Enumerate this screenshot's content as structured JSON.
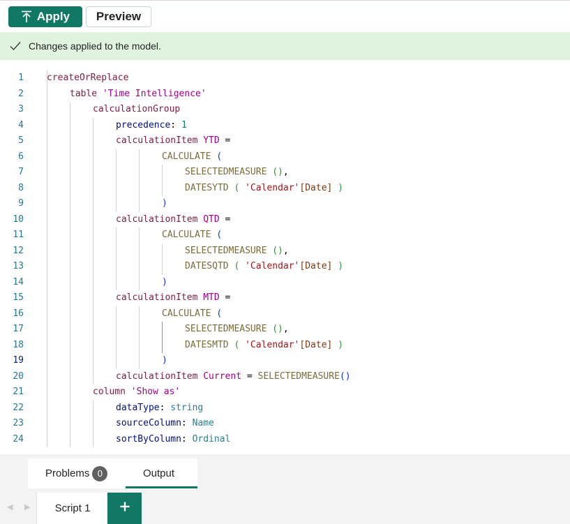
{
  "toolbar": {
    "apply_label": "Apply",
    "preview_label": "Preview"
  },
  "banner": {
    "message": "Changes applied to the model."
  },
  "editor": {
    "active_line": 19,
    "lines": [
      {
        "n": "1",
        "indent": 0,
        "tokens": [
          [
            "createOrReplace",
            "pur"
          ]
        ]
      },
      {
        "n": "2",
        "indent": 1,
        "tokens": [
          [
            "table ",
            "pur"
          ],
          [
            "'Time Intelligence'",
            "ident"
          ]
        ]
      },
      {
        "n": "3",
        "indent": 2,
        "tokens": [
          [
            "calculationGroup",
            "pur"
          ]
        ]
      },
      {
        "n": "4",
        "indent": 3,
        "tokens": [
          [
            "precedence",
            "kw"
          ],
          [
            ": ",
            "plain"
          ],
          [
            "1",
            "num"
          ]
        ]
      },
      {
        "n": "5",
        "indent": 3,
        "tokens": [
          [
            "calculationItem ",
            "pur"
          ],
          [
            "YTD",
            "ident"
          ],
          [
            " =",
            "plain"
          ]
        ]
      },
      {
        "n": "6",
        "indent": 5,
        "tokens": [
          [
            "CALCULATE ",
            "fn"
          ],
          [
            "(",
            "p1"
          ]
        ]
      },
      {
        "n": "7",
        "indent": 6,
        "tokens": [
          [
            "SELECTEDMEASURE ",
            "fn"
          ],
          [
            "()",
            "p2"
          ],
          [
            ",",
            "plain"
          ]
        ]
      },
      {
        "n": "8",
        "indent": 6,
        "tokens": [
          [
            "DATESYTD ",
            "fn"
          ],
          [
            "(",
            "p2"
          ],
          [
            " ",
            "plain"
          ],
          [
            "'Calendar'",
            "str"
          ],
          [
            "[Date]",
            "p3"
          ],
          [
            " ",
            "plain"
          ],
          [
            ")",
            "p2"
          ]
        ]
      },
      {
        "n": "9",
        "indent": 5,
        "tokens": [
          [
            ")",
            "p1"
          ]
        ]
      },
      {
        "n": "10",
        "indent": 3,
        "tokens": [
          [
            "calculationItem ",
            "pur"
          ],
          [
            "QTD",
            "ident"
          ],
          [
            " =",
            "plain"
          ]
        ]
      },
      {
        "n": "11",
        "indent": 5,
        "tokens": [
          [
            "CALCULATE ",
            "fn"
          ],
          [
            "(",
            "p1"
          ]
        ]
      },
      {
        "n": "12",
        "indent": 6,
        "tokens": [
          [
            "SELECTEDMEASURE ",
            "fn"
          ],
          [
            "()",
            "p2"
          ],
          [
            ",",
            "plain"
          ]
        ]
      },
      {
        "n": "13",
        "indent": 6,
        "tokens": [
          [
            "DATESQTD ",
            "fn"
          ],
          [
            "(",
            "p2"
          ],
          [
            " ",
            "plain"
          ],
          [
            "'Calendar'",
            "str"
          ],
          [
            "[Date]",
            "p3"
          ],
          [
            " ",
            "plain"
          ],
          [
            ")",
            "p2"
          ]
        ]
      },
      {
        "n": "14",
        "indent": 5,
        "tokens": [
          [
            ")",
            "p1"
          ]
        ]
      },
      {
        "n": "15",
        "indent": 3,
        "tokens": [
          [
            "calculationItem ",
            "pur"
          ],
          [
            "MTD",
            "ident"
          ],
          [
            " =",
            "plain"
          ]
        ]
      },
      {
        "n": "16",
        "indent": 5,
        "tokens": [
          [
            "CALCULATE ",
            "fn"
          ],
          [
            "(",
            "p1"
          ]
        ]
      },
      {
        "n": "17",
        "indent": 6,
        "tokens": [
          [
            "SELECTEDMEASURE ",
            "fn"
          ],
          [
            "()",
            "p2"
          ],
          [
            ",",
            "plain"
          ]
        ]
      },
      {
        "n": "18",
        "indent": 6,
        "tokens": [
          [
            "DATESMTD ",
            "fn"
          ],
          [
            "(",
            "p2"
          ],
          [
            " ",
            "plain"
          ],
          [
            "'Calendar'",
            "str"
          ],
          [
            "[Date]",
            "p3"
          ],
          [
            " ",
            "plain"
          ],
          [
            ")",
            "p2"
          ]
        ]
      },
      {
        "n": "19",
        "indent": 5,
        "tokens": [
          [
            ")",
            "p1"
          ]
        ]
      },
      {
        "n": "20",
        "indent": 3,
        "tokens": [
          [
            "calculationItem ",
            "pur"
          ],
          [
            "Current",
            "ident"
          ],
          [
            " = ",
            "plain"
          ],
          [
            "SELECTEDMEASURE",
            "fn"
          ],
          [
            "()",
            "p1"
          ]
        ]
      },
      {
        "n": "21",
        "indent": 2,
        "tokens": [
          [
            "column ",
            "pur"
          ],
          [
            "'Show as'",
            "ident"
          ]
        ]
      },
      {
        "n": "22",
        "indent": 3,
        "tokens": [
          [
            "dataType",
            "kw"
          ],
          [
            ": ",
            "plain"
          ],
          [
            "string",
            "typ"
          ]
        ]
      },
      {
        "n": "23",
        "indent": 3,
        "tokens": [
          [
            "sourceColumn",
            "kw"
          ],
          [
            ": ",
            "plain"
          ],
          [
            "Name",
            "typ"
          ]
        ]
      },
      {
        "n": "24",
        "indent": 3,
        "tokens": [
          [
            "sortByColumn",
            "kw"
          ],
          [
            ": ",
            "plain"
          ],
          [
            "Ordinal",
            "typ"
          ]
        ]
      }
    ]
  },
  "panel": {
    "problems_label": "Problems",
    "problems_count": "0",
    "output_label": "Output"
  },
  "script_tabs": {
    "tab_label": "Script 1",
    "add_label": "+"
  },
  "colors": {
    "accent": "#117865",
    "banner_bg": "#dff3de"
  },
  "icons": {
    "apply": "upload-arrow-icon",
    "success": "checkmark-icon",
    "add": "plus-icon",
    "nav_left": "chevron-left-icon",
    "nav_right": "chevron-right-icon"
  }
}
